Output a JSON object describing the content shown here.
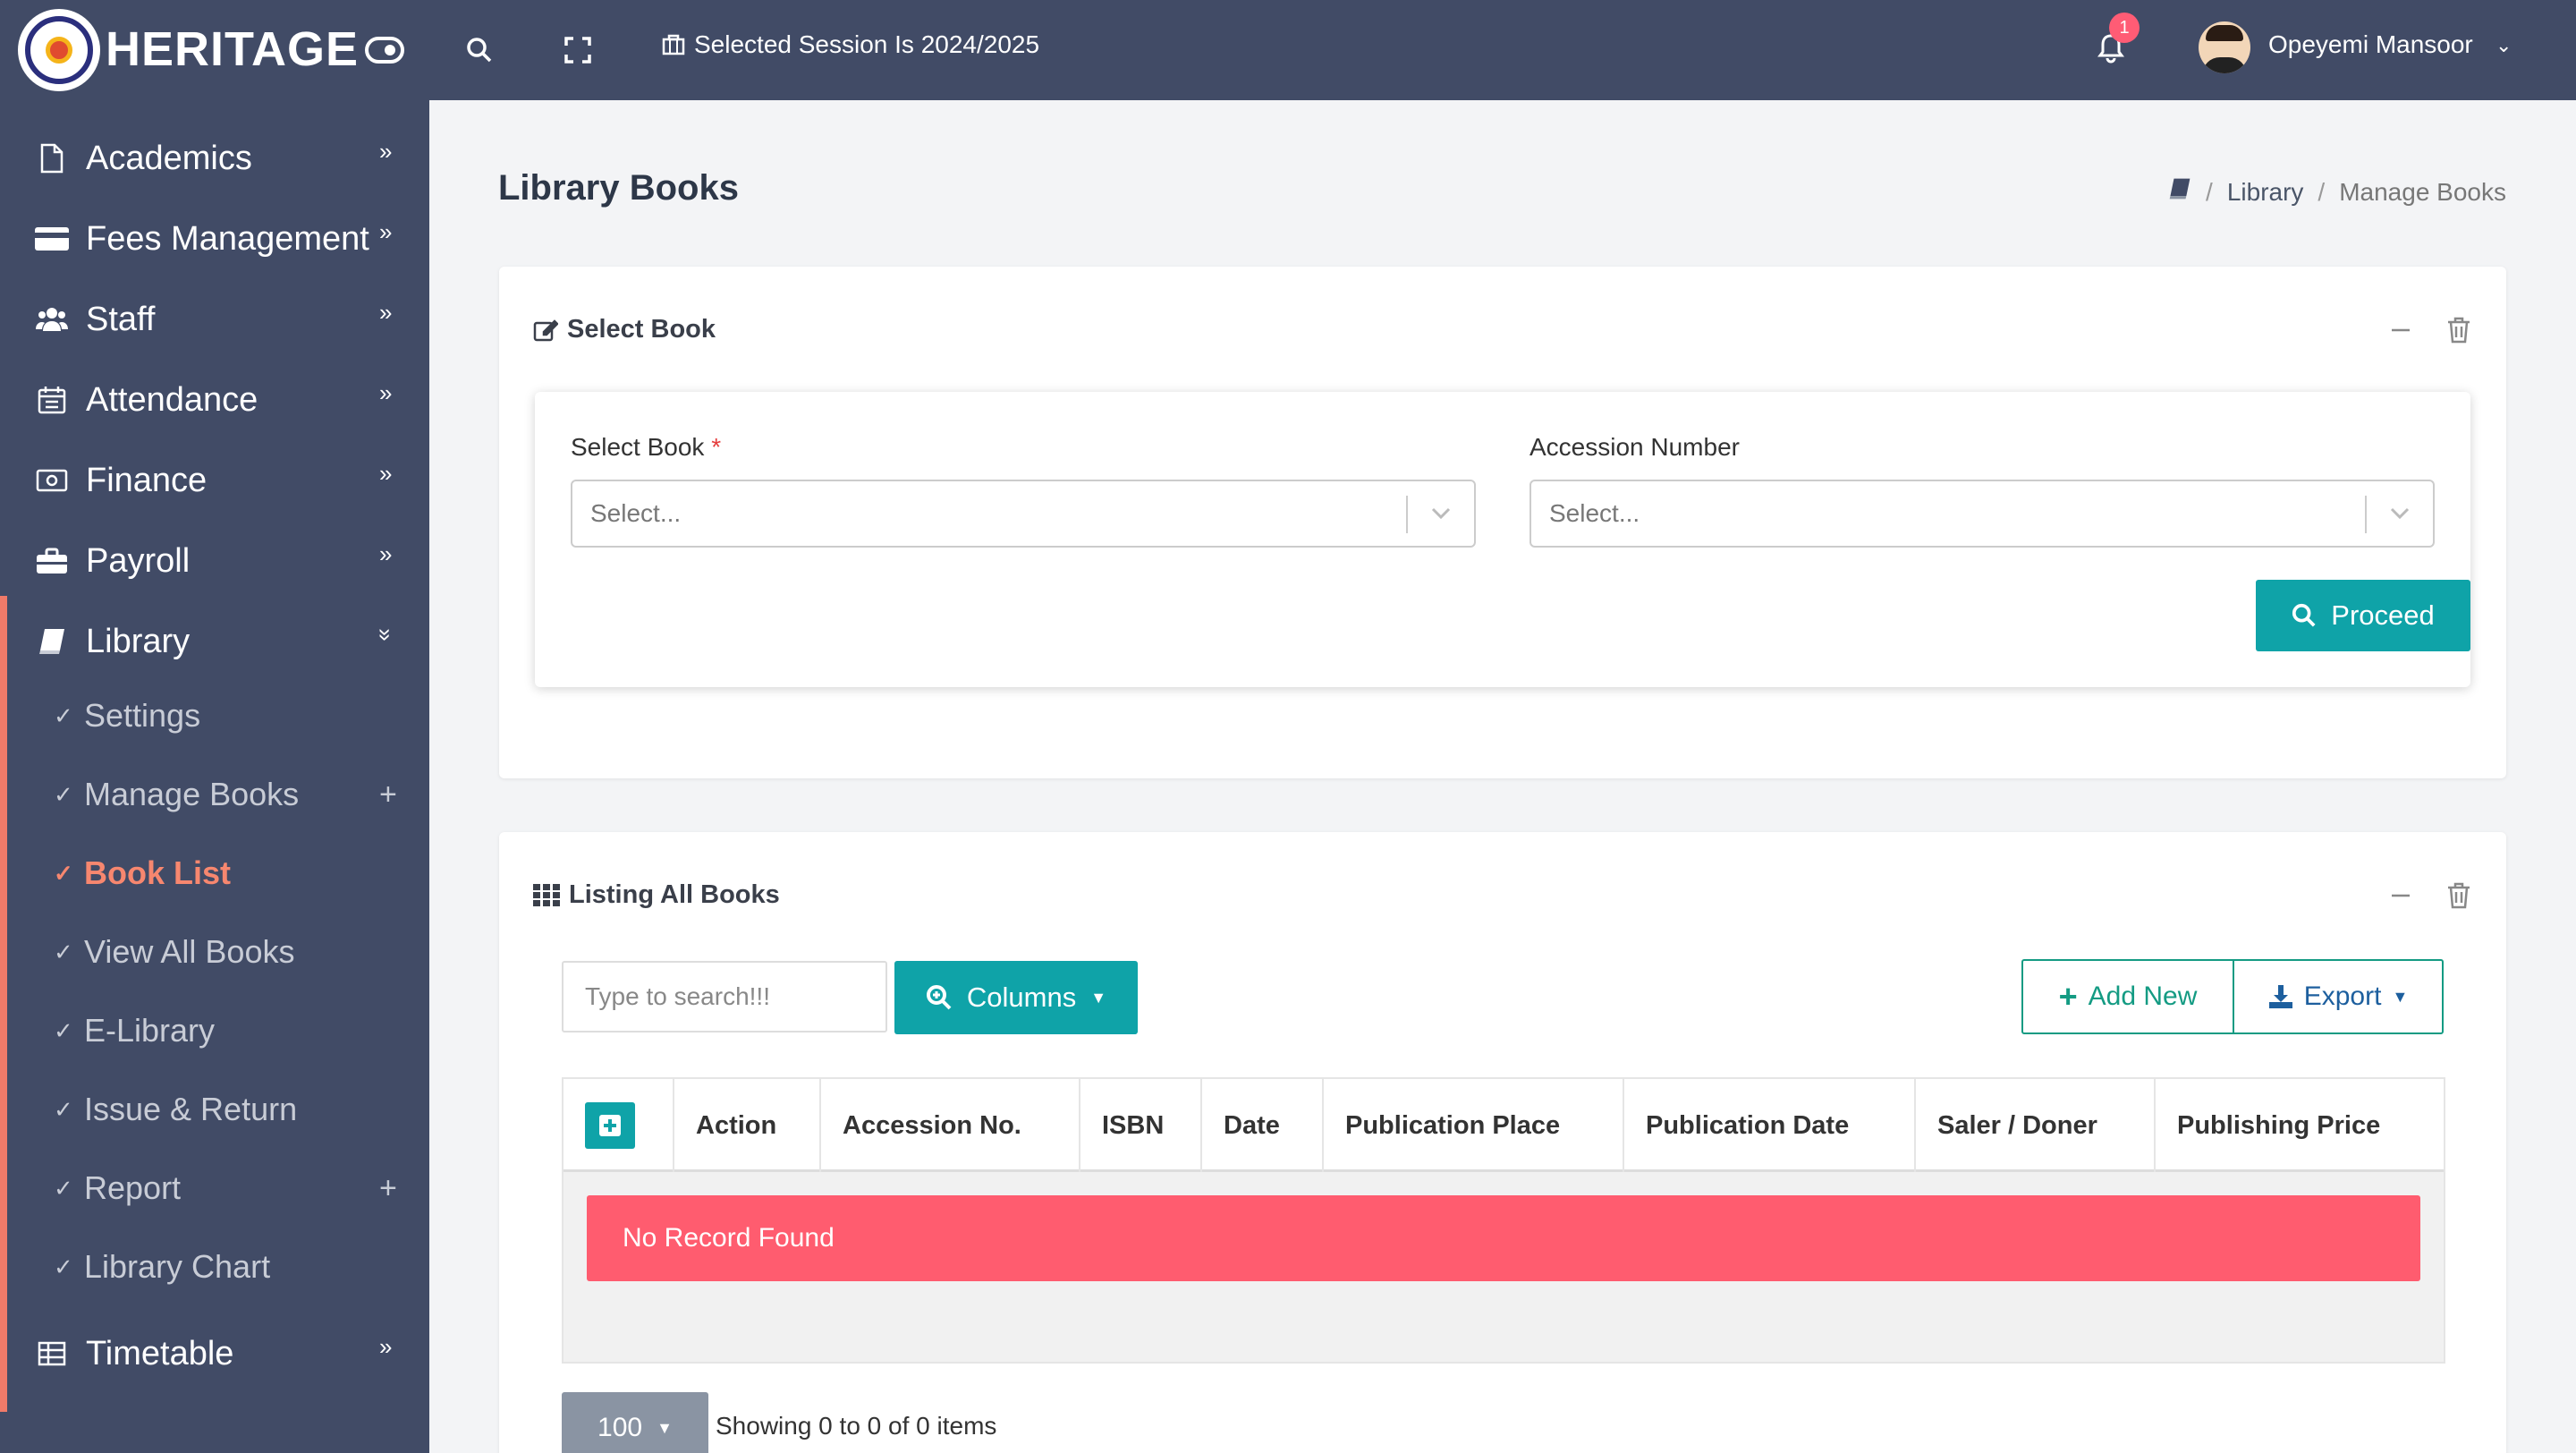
{
  "header": {
    "brand": "HERITAGE",
    "session": "Selected Session Is 2024/2025",
    "notification_count": "1",
    "user_name": "Opeyemi Mansoor"
  },
  "sidebar": {
    "items": [
      {
        "label": "Academics",
        "icon": "file-icon"
      },
      {
        "label": "Fees Management",
        "icon": "credit-card-icon"
      },
      {
        "label": "Staff",
        "icon": "users-icon"
      },
      {
        "label": "Attendance",
        "icon": "calendar-icon"
      },
      {
        "label": "Finance",
        "icon": "money-icon"
      },
      {
        "label": "Payroll",
        "icon": "briefcase-icon"
      },
      {
        "label": "Library",
        "icon": "book-icon"
      }
    ],
    "library_sub": [
      {
        "label": "Settings"
      },
      {
        "label": "Manage Books"
      },
      {
        "label": "Book List"
      },
      {
        "label": "View All Books"
      },
      {
        "label": "E-Library"
      },
      {
        "label": "Issue & Return"
      },
      {
        "label": "Report"
      },
      {
        "label": "Library Chart"
      }
    ],
    "timetable": {
      "label": "Timetable",
      "icon": "table-icon"
    }
  },
  "page": {
    "title": "Library Books",
    "breadcrumb": [
      "Library",
      "Manage Books"
    ]
  },
  "select_card": {
    "title": "Select Book",
    "book_label": "Select Book",
    "book_required": "*",
    "book_placeholder": "Select...",
    "accession_label": "Accession Number",
    "accession_placeholder": "Select...",
    "proceed_label": "Proceed"
  },
  "listing_card": {
    "title": "Listing All Books",
    "search_placeholder": "Type to search!!!",
    "columns_label": "Columns",
    "add_new_label": "Add New",
    "export_label": "Export",
    "columns": [
      "Action",
      "Accession No.",
      "ISBN",
      "Date",
      "Publication Place",
      "Publication Date",
      "Saler / Doner",
      "Publishing Price"
    ],
    "empty_message": "No Record Found",
    "page_size": "100",
    "showing_text": "Showing 0 to 0 of 0 items"
  },
  "colors": {
    "topbar": "#414b66",
    "accent_teal": "#0fa3a8",
    "active_nav": "#f7876f",
    "danger": "#ff5c6f"
  }
}
